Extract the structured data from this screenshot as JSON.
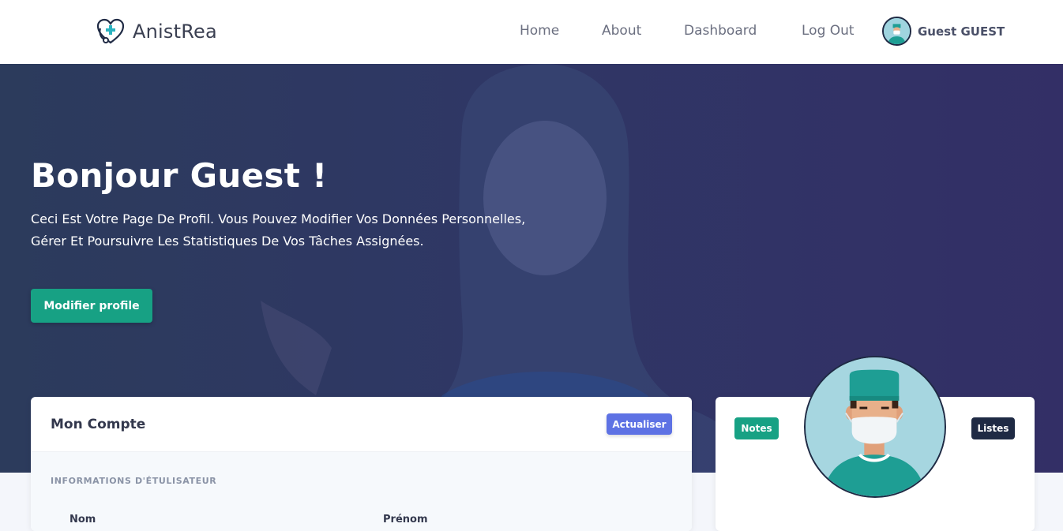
{
  "brand": {
    "name": "AnistRea",
    "icon": "heart-stethoscope-icon"
  },
  "nav": {
    "links": [
      "Home",
      "About",
      "Dashboard",
      "Log Out"
    ],
    "user_name": "Guest GUEST",
    "user_avatar": "doctor-avatar-icon"
  },
  "hero": {
    "title": "Bonjour Guest !",
    "description_line1": "Ceci Est Votre Page De Profil. Vous Pouvez Modifier Vos Données Personnelles,",
    "description_line2": "Gérer Et Poursuivre Les Statistiques De Vos Tâches Assignées.",
    "button": "Modifier profile"
  },
  "account_card": {
    "title": "Mon Compte",
    "refresh_button": "Actualiser",
    "section_heading": "INFORMATIONS D'ÉTULISATEUR",
    "fields": [
      "Nom",
      "Prénom"
    ]
  },
  "profile_card": {
    "notes_button": "Notes",
    "lists_button": "Listes",
    "avatar": "doctor-avatar-icon"
  },
  "colors": {
    "primary_green": "#17a184",
    "accent_blue": "#5e72e4",
    "dark_navy": "#1f2a44",
    "hero_overlay": "#2f3765"
  }
}
